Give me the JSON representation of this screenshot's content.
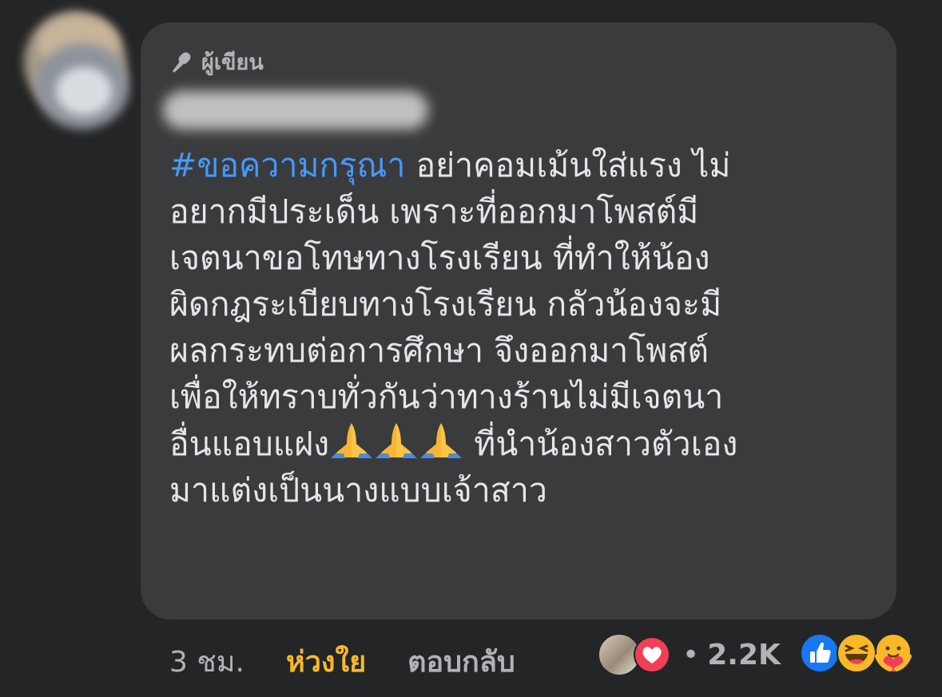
{
  "comment": {
    "author_badge": "ผู้เขียน",
    "hashtag": "#ขอความกรุณา",
    "text_part1": " อย่าคอมเม้นใส่แรง ไม่\nอยากมีประเด็น เพราะที่ออกมาโพสต์มี\nเจตนาขอโทษทางโรงเรียน ที่ทำให้น้อง\nผิดกฎระเบียบทางโรงเรียน กลัวน้องจะมี\nผลกระทบต่อการศึกษา จึงออกมาโพสต์\nเพื่อให้ทราบทั่วกันว่าทางร้านไม่มีเจตนา\nอื่นแอบแฝง",
    "emojis": [
      "folded-hands",
      "folded-hands",
      "folded-hands"
    ],
    "text_part2": " ที่นำน้องสาวตัวเอง\nมาแต่งเป็นนางแบบเจ้าสาว"
  },
  "actions": {
    "timestamp": "3 ชม.",
    "care_label": "ห่วงใย",
    "reply_label": "ตอบกลับ"
  },
  "reactions": {
    "separator": "•",
    "count": "2.2K",
    "icons": [
      "like",
      "haha",
      "care"
    ]
  },
  "colors": {
    "background": "#242526",
    "bubble": "#3a3b3c",
    "hashtag": "#4599ff",
    "care": "#f7b928",
    "like": "#1877f2",
    "heart": "#f33e58"
  }
}
